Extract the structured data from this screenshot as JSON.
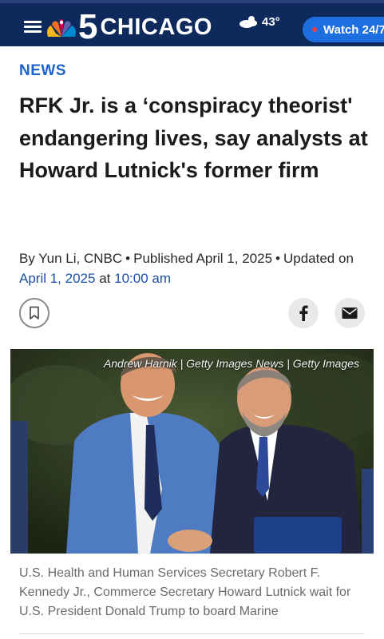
{
  "header": {
    "logo_number": "5",
    "logo_city": "CHICAGO",
    "weather_icon": "cloud-sun-icon",
    "temperature": "43°",
    "watch_label": "Watch 24/7",
    "bg_color": "#0e2a5c",
    "accent_color": "#1d6fe0"
  },
  "article": {
    "section": "NEWS",
    "headline": "RFK Jr. is a ‘conspiracy theorist' endangering lives, say analysts at Howard Lutnick's former firm",
    "byline": {
      "prefix": "By",
      "author": "Yun Li, CNBC",
      "published_label": "Published",
      "published_date": "April 1, 2025",
      "updated_label": "Updated",
      "on_label": "on",
      "updated_date": "April 1, 2025",
      "at_label": "at",
      "updated_time": "10:00 am"
    },
    "actions": {
      "bookmark_icon": "bookmark-icon",
      "facebook_icon": "facebook-icon",
      "email_icon": "email-icon"
    },
    "photo": {
      "credit": "Andrew Harnik | Getty Images News | Getty Images"
    },
    "caption": "U.S. Health and Human Services Secretary Robert F. Kennedy Jr., Commerce Secretary Howard Lutnick wait for U.S. President Donald Trump to board Marine"
  }
}
